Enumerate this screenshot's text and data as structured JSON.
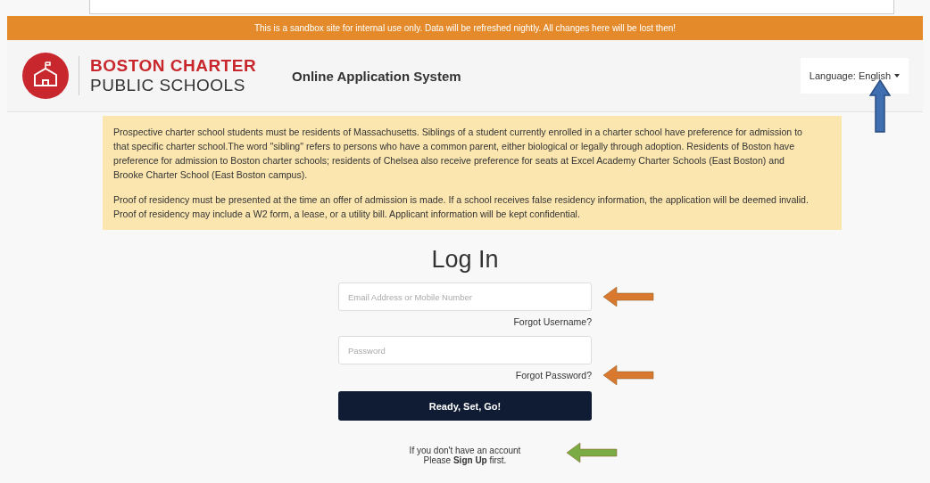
{
  "banner": "This is a sandbox site for internal use only. Data will be refreshed nightly. All changes here will be lost then!",
  "header": {
    "logo_line_1": "BOSTON CHARTER",
    "logo_line_2": "PUBLIC SCHOOLS",
    "app_title": "Online Application System",
    "language_label": "Language:",
    "language_value": "English",
    "language_arrow": {
      "color": "#3f6fb0"
    }
  },
  "notice": [
    "Prospective charter school students must be residents of Massachusetts. Siblings of a student currently enrolled in a charter school have preference for admission to that specific charter school.The word \"sibling\" refers to persons who have a common parent, either biological or legally through adoption. Residents of Boston have preference for admission to Boston charter schools; residents of Chelsea also receive preference for seats at Excel Academy Charter Schools (East Boston) and Brooke Charter School (East Boston campus).",
    "Proof of residency must be presented at the time an offer of admission is made. If a school receives false residency information, the application will be deemed invalid. Proof of residency may include a W2 form, a lease, or a utility bill. Applicant information will be kept confidential."
  ],
  "login": {
    "title": "Log In",
    "email": {
      "placeholder": "Email Address or Mobile Number",
      "arrow": {
        "color": "#d9782f"
      }
    },
    "forgot_username": "Forgot Username?",
    "password": {
      "placeholder": "Password"
    },
    "forgot_password": {
      "label": "Forgot Password?",
      "arrow": {
        "color": "#d9782f"
      }
    },
    "submit": "Ready, Set, Go!",
    "signup": {
      "line_1": "If you don't have an account",
      "line_2": "Please **Sign Up** first.",
      "arrow": {
        "color": "#7aab45"
      }
    }
  }
}
